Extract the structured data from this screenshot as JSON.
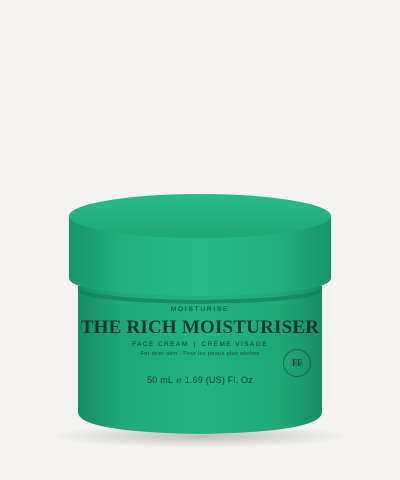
{
  "product": {
    "category": "MOISTURISE",
    "name": "THE RICH MOISTURISER",
    "type_en": "FACE CREAM",
    "separator": "|",
    "type_fr": "CRÈME VISAGE",
    "skin_note": "For drier skin · Pour les peaux plus sèches",
    "volume_ml": "50 mL",
    "estimated_sign": "℮",
    "volume_floz": "1.69 (US) Fl. Oz",
    "monogram": "FF"
  },
  "colors": {
    "background": "#f4f3f1",
    "jar_green": "#1faa7a",
    "label_text": "#123a2c"
  }
}
